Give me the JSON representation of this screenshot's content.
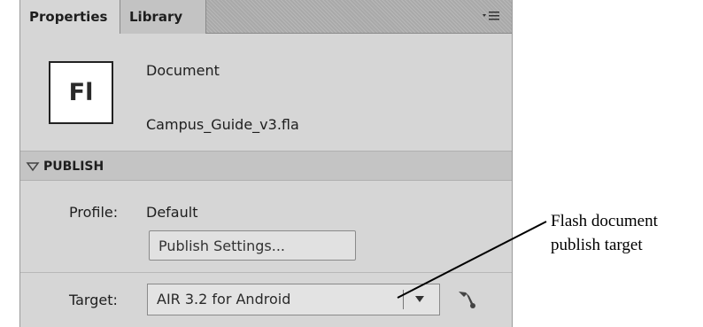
{
  "tabs": [
    {
      "label": "Properties"
    },
    {
      "label": "Library"
    }
  ],
  "document": {
    "icon_text": "Fl",
    "type_label": "Document",
    "file_name": "Campus_Guide_v3.fla"
  },
  "publish": {
    "section_title": "PUBLISH",
    "profile_label": "Profile:",
    "profile_value": "Default",
    "settings_button": "Publish Settings...",
    "target_label": "Target:",
    "target_value": "AIR 3.2 for Android"
  },
  "callout": {
    "line1": "Flash document",
    "line2": "publish target"
  },
  "icons": {
    "panel_menu": "panel-menu-icon",
    "collapse": "triangle-down-icon",
    "dropdown": "chevron-down-icon",
    "settings": "wrench-icon"
  }
}
